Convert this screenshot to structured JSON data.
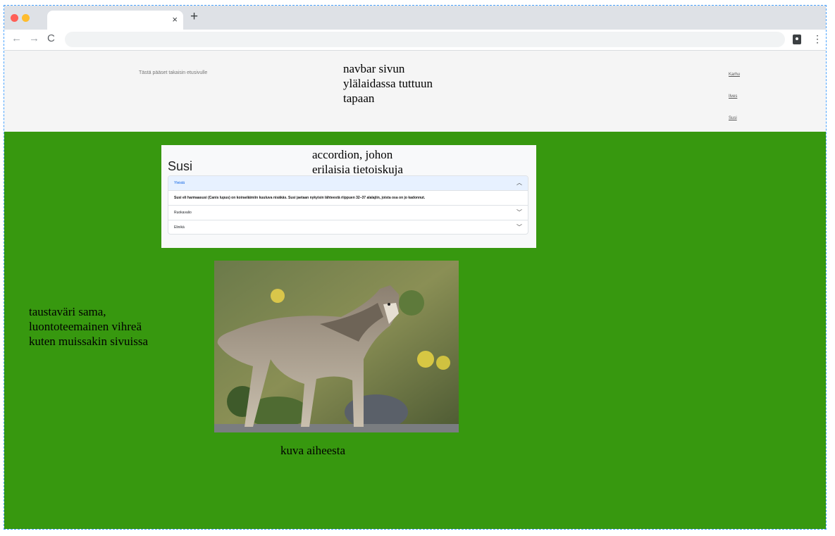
{
  "browser": {
    "tab_title": "",
    "close_tab_glyph": "×",
    "new_tab_glyph": "+",
    "back_glyph": "←",
    "forward_glyph": "→",
    "reload_glyph": "C",
    "menu_glyph": "⋮",
    "address": ""
  },
  "navbar": {
    "home_link": "Tästä pääset takaisin etusivulle",
    "links": [
      "Karhu",
      "Ilves",
      "Susi"
    ]
  },
  "annotations": {
    "navbar_note": [
      "navbar sivun",
      "ylälaidassa tuttuun",
      "tapaan"
    ],
    "accordion_note": [
      "accordion, johon",
      "erilaisia tietoiskuja"
    ],
    "background_note": [
      "taustaväri sama,",
      "luontoteemainen vihreä",
      "kuten muissakin sivuissa"
    ],
    "image_note": "kuva aiheesta"
  },
  "card": {
    "title": "Susi",
    "items": [
      {
        "label": "Yleistä",
        "expanded": true,
        "body": "Susi eli harmaasusi (Canis lupus) on koiraeläimiin kuuluva nisäkäs. Susi jaetaan nykyisin lähteestä riippuen 32–37 alalajiin, joista osa on jo kadonnut."
      },
      {
        "label": "Ruokavalio",
        "expanded": false
      },
      {
        "label": "Elinikä",
        "expanded": false
      }
    ]
  },
  "colors": {
    "page_background": "#37980f",
    "navbar_background": "#f5f5f5",
    "accordion_active": "#e7f1ff"
  },
  "icons": {
    "chevron_up": "chevron-up-icon",
    "chevron_down": "chevron-down-icon",
    "wolf_image": "wolf-photo"
  }
}
